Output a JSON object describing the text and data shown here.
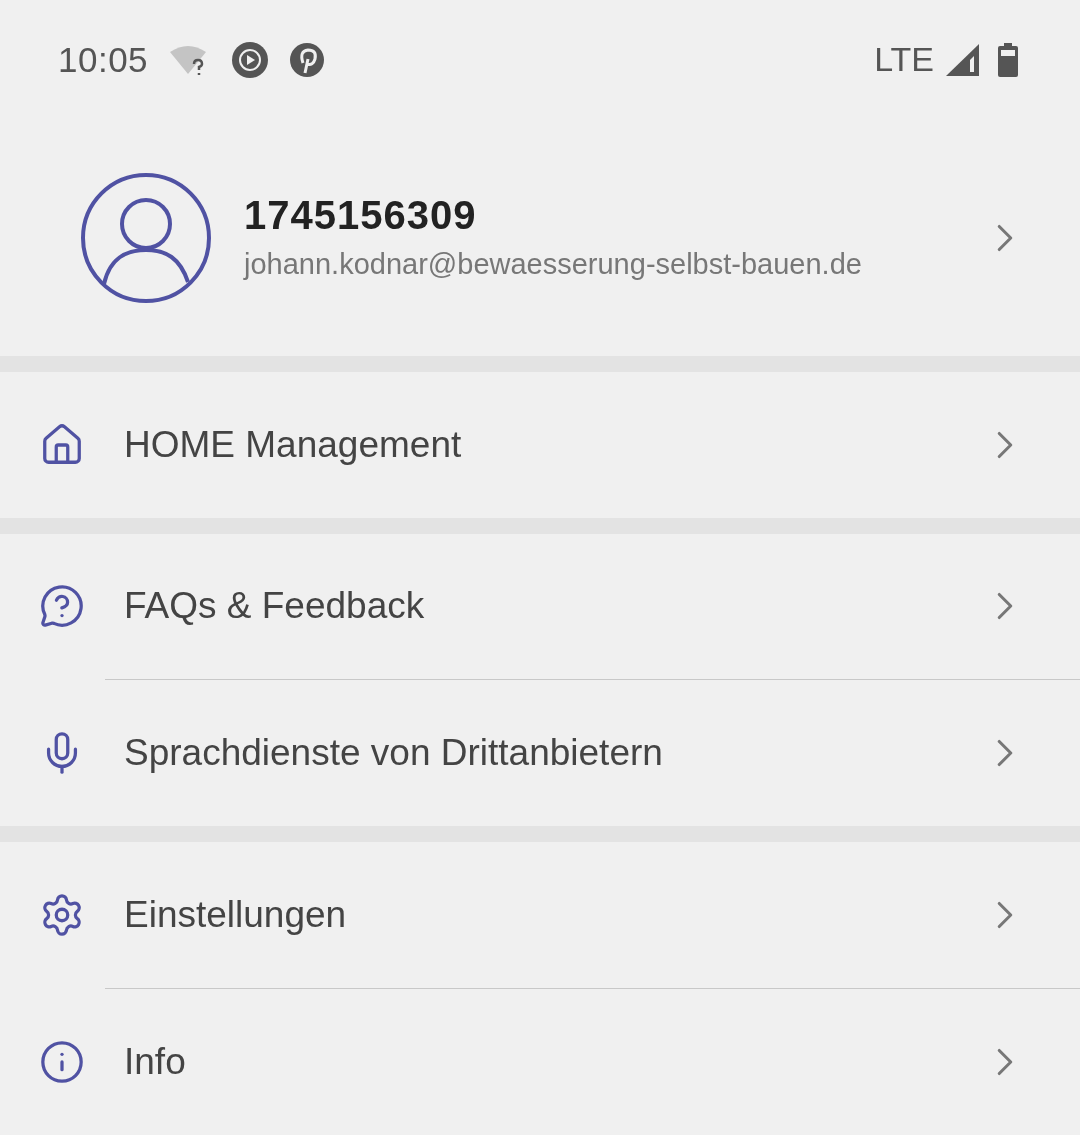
{
  "status_bar": {
    "time": "10:05",
    "network": "LTE"
  },
  "profile": {
    "name": "1745156309",
    "email": "johann.kodnar@bewaesserung-selbst-bauen.de"
  },
  "groups": [
    {
      "items": [
        {
          "kind": "home",
          "label": "HOME Management"
        }
      ]
    },
    {
      "items": [
        {
          "kind": "faq",
          "label": "FAQs & Feedback"
        },
        {
          "kind": "voice",
          "label": "Sprachdienste von Drittanbietern"
        }
      ]
    },
    {
      "items": [
        {
          "kind": "settings",
          "label": "Einstellungen"
        },
        {
          "kind": "info",
          "label": "Info"
        }
      ]
    }
  ]
}
